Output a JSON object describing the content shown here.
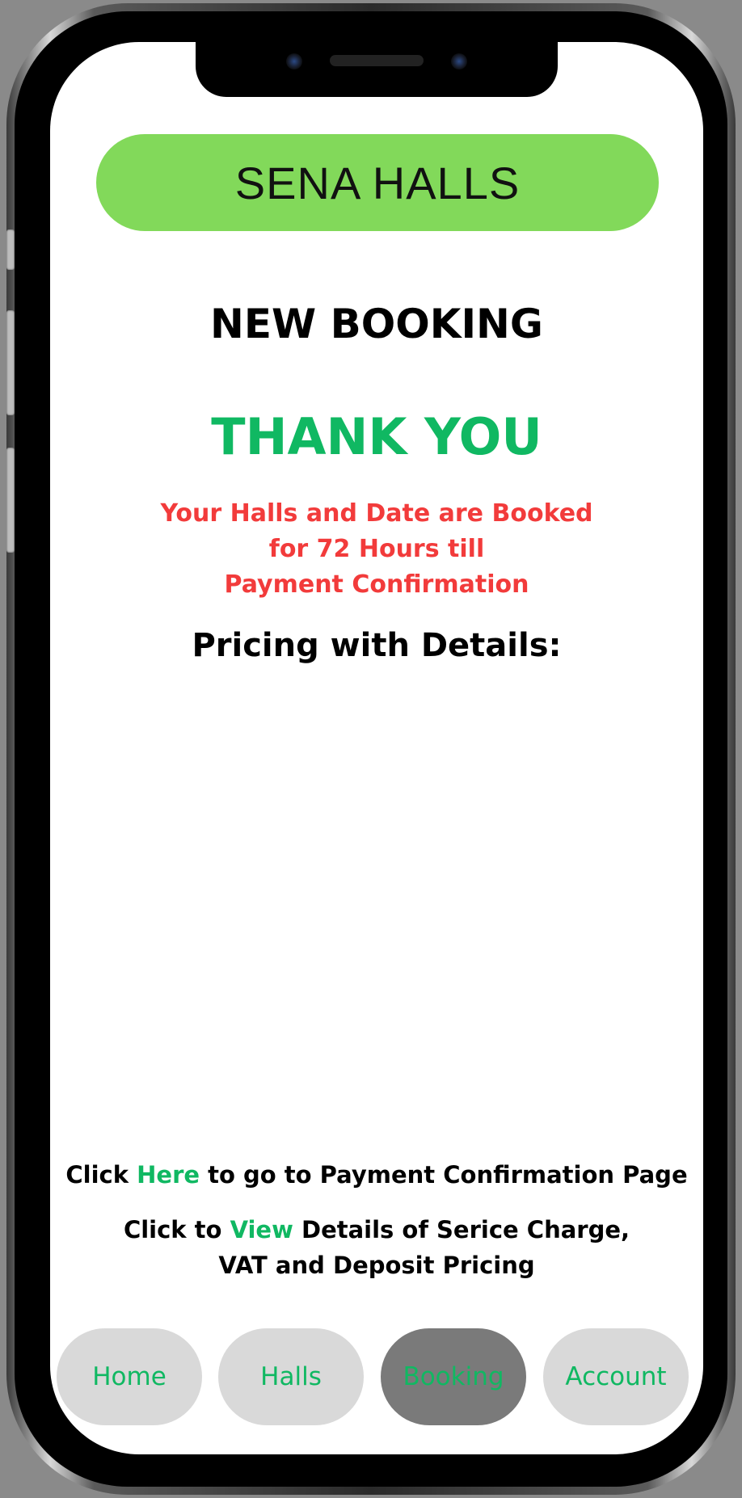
{
  "header": {
    "title": "SENA HALLS"
  },
  "page": {
    "title": "NEW BOOKING",
    "thank_you": "THANK YOU",
    "booked_message": [
      "Your Halls and Date are Booked",
      "for 72 Hours till",
      "Payment Confirmation"
    ],
    "pricing_heading": "Pricing with Details:"
  },
  "payment_link": {
    "prefix": "Click ",
    "link": "Here",
    "suffix": " to go to Payment Confirmation Page"
  },
  "view_link": {
    "prefix": "Click to ",
    "link": "View",
    "suffix": " Details of Serice Charge,",
    "line2": "VAT and Deposit Pricing"
  },
  "nav": {
    "items": [
      {
        "label": "Home",
        "active": false
      },
      {
        "label": "Halls",
        "active": false
      },
      {
        "label": "Booking",
        "active": true
      },
      {
        "label": "Account",
        "active": false
      }
    ]
  },
  "colors": {
    "header_bg": "#82d95a",
    "accent_green": "#10b862",
    "alert_red": "#f23b3b",
    "nav_bg": "#d9d9d9",
    "nav_active_bg": "#7a7a7a"
  }
}
